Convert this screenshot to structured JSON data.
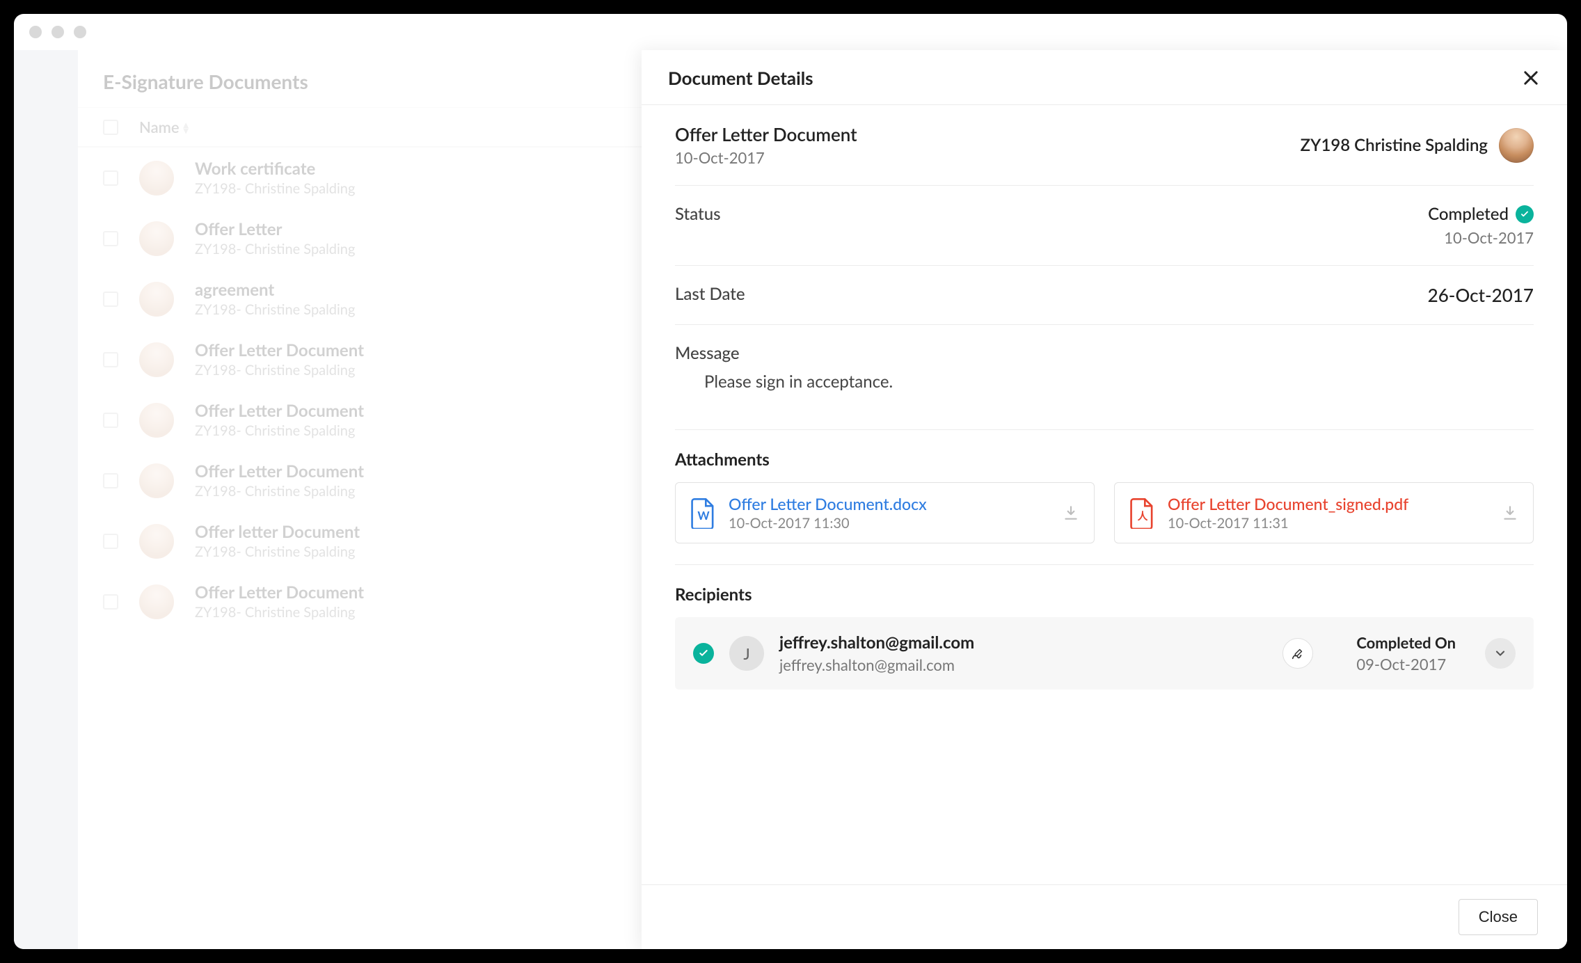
{
  "list": {
    "title": "E-Signature Documents",
    "columns": {
      "name": "Name"
    },
    "rows": [
      {
        "title": "Work certificate",
        "code": "ZY198",
        "person": "Christine Spalding"
      },
      {
        "title": "Offer Letter",
        "code": "ZY198",
        "person": "Christine Spalding"
      },
      {
        "title": "agreement",
        "code": "ZY198",
        "person": "Christine Spalding"
      },
      {
        "title": "Offer Letter Document",
        "code": "ZY198",
        "person": "Christine Spalding"
      },
      {
        "title": "Offer Letter Document",
        "code": "ZY198",
        "person": "Christine Spalding"
      },
      {
        "title": "Offer Letter Document",
        "code": "ZY198",
        "person": "Christine Spalding"
      },
      {
        "title": "Offer letter Document",
        "code": "ZY198",
        "person": "Christine Spalding"
      },
      {
        "title": "Offer Letter Document",
        "code": "ZY198",
        "person": "Christine Spalding"
      }
    ]
  },
  "panel": {
    "title": "Document Details",
    "doc": {
      "name": "Offer Letter Document",
      "date": "10-Oct-2017",
      "user": "ZY198 Christine Spalding"
    },
    "status_label": "Status",
    "status": {
      "text": "Completed",
      "date": "10-Oct-2017"
    },
    "lastdate_label": "Last Date",
    "lastdate": "26-Oct-2017",
    "message_label": "Message",
    "message_body": "Please sign in acceptance.",
    "attachments_label": "Attachments",
    "attachments": [
      {
        "name": "Offer Letter Document.docx",
        "date": "10-Oct-2017 11:30",
        "type": "word"
      },
      {
        "name": "Offer Letter Document_signed.pdf",
        "date": "10-Oct-2017 11:31",
        "type": "pdf"
      }
    ],
    "recipients_label": "Recipients",
    "recipients": [
      {
        "initial": "J",
        "name": "jeffrey.shalton@gmail.com",
        "email": "jeffrey.shalton@gmail.com",
        "completed_label": "Completed On",
        "completed_date": "09-Oct-2017"
      }
    ],
    "close_label": "Close"
  }
}
